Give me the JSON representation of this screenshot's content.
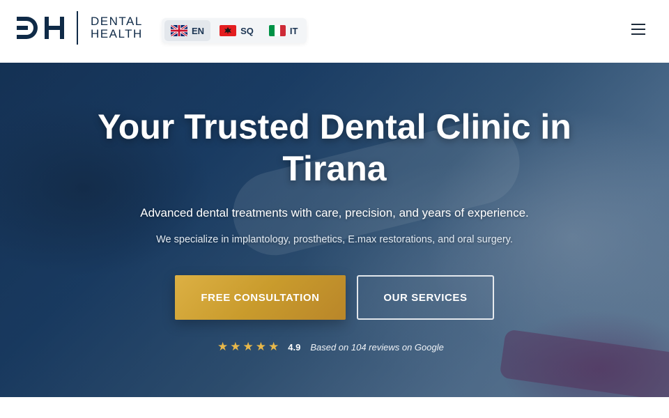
{
  "brand": {
    "logo_text_line1": "DENTAL",
    "logo_text_line2": "HEALTH",
    "color_primary": "#0f2a47",
    "color_accent": "#c99b2c"
  },
  "languages": [
    {
      "code": "EN",
      "flag": "uk-flag-icon",
      "active": true
    },
    {
      "code": "SQ",
      "flag": "albania-flag-icon",
      "active": false
    },
    {
      "code": "IT",
      "flag": "italy-flag-icon",
      "active": false
    }
  ],
  "menu": {
    "icon": "hamburger-menu-icon"
  },
  "hero": {
    "title_line1": "Your Trusted Dental Clinic in",
    "title_line2": "Tirana",
    "subtitle": "Advanced dental treatments with care, precision, and years of experience.",
    "description": "We specialize in implantology, prosthetics, E.max restorations, and oral surgery.",
    "primary_button": "FREE CONSULTATION",
    "secondary_button": "OUR SERVICES",
    "rating": {
      "stars": 5,
      "score": "4.9",
      "text": "Based on 104 reviews on Google"
    }
  }
}
